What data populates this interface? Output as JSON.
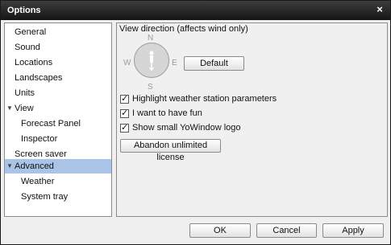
{
  "window": {
    "title": "Options",
    "close_symbol": "×"
  },
  "sidebar": {
    "items": [
      {
        "label": "General"
      },
      {
        "label": "Sound"
      },
      {
        "label": "Locations"
      },
      {
        "label": "Landscapes"
      },
      {
        "label": "Units"
      },
      {
        "label": "View",
        "arrow": "▼",
        "expanded": true
      },
      {
        "label": "Forecast Panel"
      },
      {
        "label": "Inspector"
      },
      {
        "label": "Screen saver"
      },
      {
        "label": "Advanced",
        "arrow": "▼",
        "expanded": true,
        "selected": true
      },
      {
        "label": "Weather"
      },
      {
        "label": "System tray"
      }
    ]
  },
  "advanced": {
    "view_direction_label": "View direction (affects wind only)",
    "compass": {
      "n": "N",
      "s": "S",
      "e": "E",
      "w": "W"
    },
    "default_button": "Default",
    "checkboxes": [
      {
        "label": "Highlight weather station parameters",
        "checked": true
      },
      {
        "label": "I want to have fun",
        "checked": true
      },
      {
        "label": "Show small YoWindow logo",
        "checked": true
      }
    ],
    "abandon_button": "Abandon unlimited license"
  },
  "footer": {
    "ok": "OK",
    "cancel": "Cancel",
    "apply": "Apply"
  },
  "colors": {
    "selection": "#a9c4e6",
    "titlebar": "#1f1f1f"
  }
}
